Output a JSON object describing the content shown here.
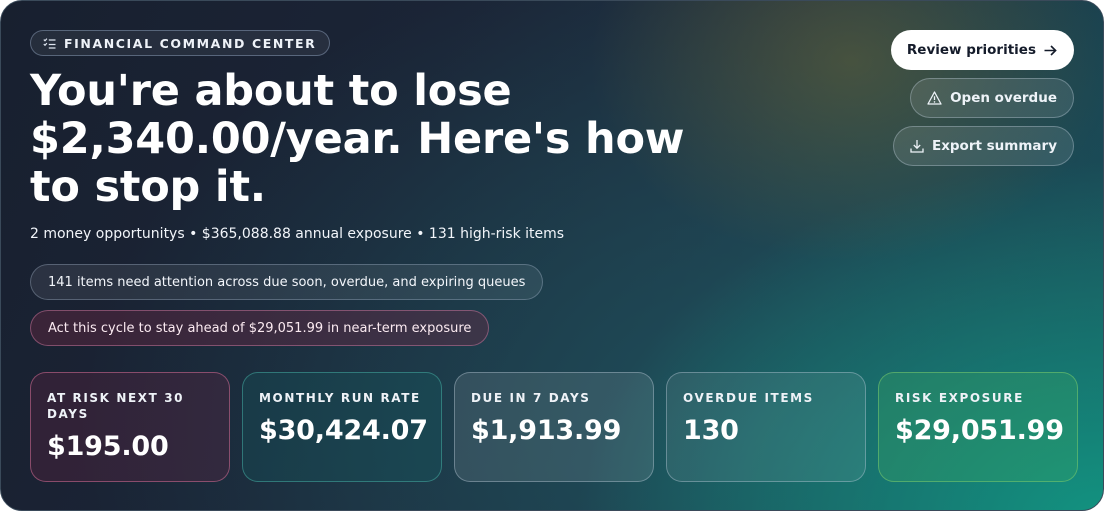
{
  "eyebrow": {
    "icon": "checklist-icon",
    "label": "FINANCIAL COMMAND CENTER"
  },
  "headline": "You're about to lose $2,340.00/year. Here's how to stop it.",
  "subline": "2 money opportunitys • $365,088.88 annual exposure • 131 high-risk items",
  "pills": {
    "attention": "141 items need attention across due soon, overdue, and expiring queues",
    "cycle": "Act this cycle to stay ahead of $29,051.99 in near-term exposure"
  },
  "actions": {
    "review": {
      "label": "Review priorities",
      "icon": "arrow-right-icon"
    },
    "overdue": {
      "label": "Open overdue",
      "icon": "warning-triangle-icon"
    },
    "export": {
      "label": "Export summary",
      "icon": "download-icon"
    }
  },
  "cards": [
    {
      "label": "AT RISK NEXT 30 DAYS",
      "value": "$195.00",
      "accent": "#d46e96"
    },
    {
      "label": "MONTHLY RUN RATE",
      "value": "$30,424.07",
      "accent": "#46aaa0"
    },
    {
      "label": "DUE IN 7 DAYS",
      "value": "$1,913.99",
      "accent": "#becddc"
    },
    {
      "label": "OVERDUE ITEMS",
      "value": "130",
      "accent": "#becddc"
    },
    {
      "label": "RISK EXPOSURE",
      "value": "$29,051.99",
      "accent": "#78c86e"
    }
  ]
}
